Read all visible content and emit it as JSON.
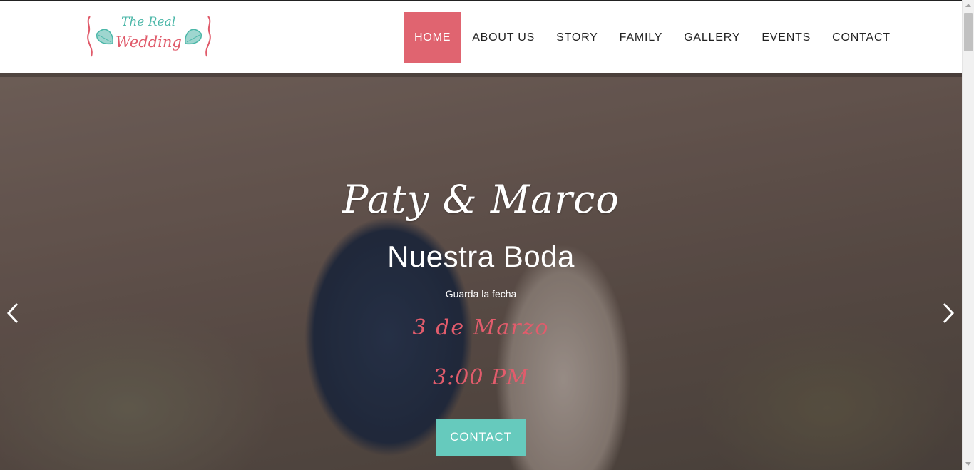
{
  "logo": {
    "line1": "The Real",
    "line2": "Wedding"
  },
  "nav": {
    "items": [
      {
        "label": "HOME",
        "active": true
      },
      {
        "label": "ABOUT US"
      },
      {
        "label": "STORY"
      },
      {
        "label": "FAMILY"
      },
      {
        "label": "GALLERY"
      },
      {
        "label": "EVENTS"
      },
      {
        "label": "CONTACT"
      }
    ]
  },
  "hero": {
    "names": "Paty  &  Marco",
    "subtitle": "Nuestra Boda",
    "save_date": "Guarda la fecha",
    "date": "3 de Marzo",
    "time": "3:00 PM",
    "cta_label": "CONTACT"
  },
  "colors": {
    "accent": "#e06470",
    "cta": "#66cabd",
    "date_text": "#e25c6c",
    "logo_teal": "#4bb7a8"
  }
}
